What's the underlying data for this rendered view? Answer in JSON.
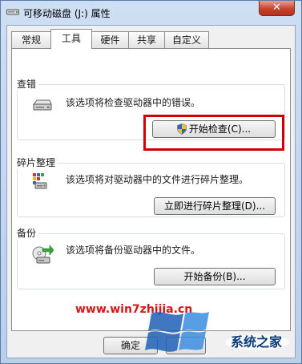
{
  "window": {
    "title": "可移动磁盘 (J:) 属性",
    "close_label": "✕"
  },
  "tabs": [
    {
      "label": "常规",
      "active": false
    },
    {
      "label": "工具",
      "active": true
    },
    {
      "label": "硬件",
      "active": false
    },
    {
      "label": "共享",
      "active": false
    },
    {
      "label": "自定义",
      "active": false
    }
  ],
  "groups": {
    "error_check": {
      "title": "查错",
      "description": "该选项将检查驱动器中的错误。",
      "button": "开始检查(C)..."
    },
    "defrag": {
      "title": "碎片整理",
      "description": "该选项将对驱动器中的文件进行碎片整理。",
      "button": "立即进行碎片整理(D)..."
    },
    "backup": {
      "title": "备份",
      "description": "该选项将备份驱动器中的文件。",
      "button": "开始备份(B)..."
    }
  },
  "footer": {
    "ok_label": "确定"
  },
  "watermark": {
    "url": "www.win7zhijia.cn",
    "site_name": "系统之家"
  },
  "colors": {
    "highlight": "#d20000",
    "watermark_red": "#d81414",
    "watermark_blue": "#0b3d78"
  }
}
